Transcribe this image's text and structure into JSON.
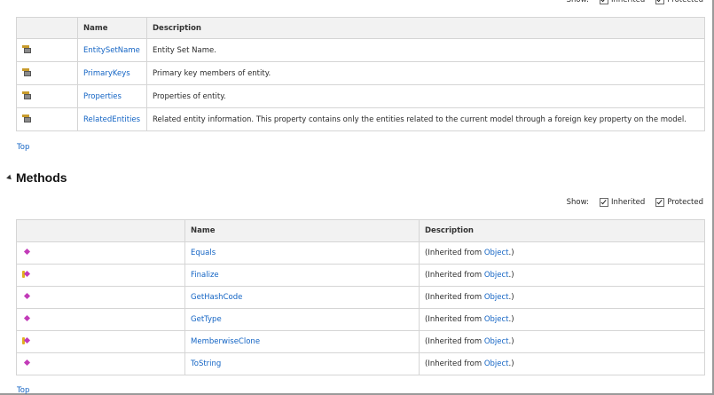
{
  "show": {
    "label": "Show:",
    "inherited": "Inherited",
    "protected": "Protected"
  },
  "properties": {
    "columns": [
      "",
      "Name",
      "Description"
    ],
    "rows": [
      {
        "name": "EntitySetName",
        "description": "Entity Set Name."
      },
      {
        "name": "PrimaryKeys",
        "description": "Primary key members of entity."
      },
      {
        "name": "Properties",
        "description": "Properties of entity."
      },
      {
        "name": "RelatedEntities",
        "description": "Related entity information. This property contains only the entities related to the current model through a foreign key property on the model."
      }
    ]
  },
  "top_link": "Top",
  "methods": {
    "heading": "Methods",
    "columns": [
      "",
      "Name",
      "Description"
    ],
    "inherited_prefix": "(Inherited from ",
    "inherited_link": "Object",
    "inherited_suffix": ".)",
    "rows": [
      {
        "name": "Equals",
        "icon": "public-method-icon"
      },
      {
        "name": "Finalize",
        "icon": "protected-method-icon"
      },
      {
        "name": "GetHashCode",
        "icon": "public-method-icon"
      },
      {
        "name": "GetType",
        "icon": "public-method-icon"
      },
      {
        "name": "MemberwiseClone",
        "icon": "protected-method-icon"
      },
      {
        "name": "ToString",
        "icon": "public-method-icon"
      }
    ]
  },
  "colors": {
    "link": "#1364c4",
    "header_bg": "#f2f2f2",
    "border": "#d5d5d5"
  }
}
